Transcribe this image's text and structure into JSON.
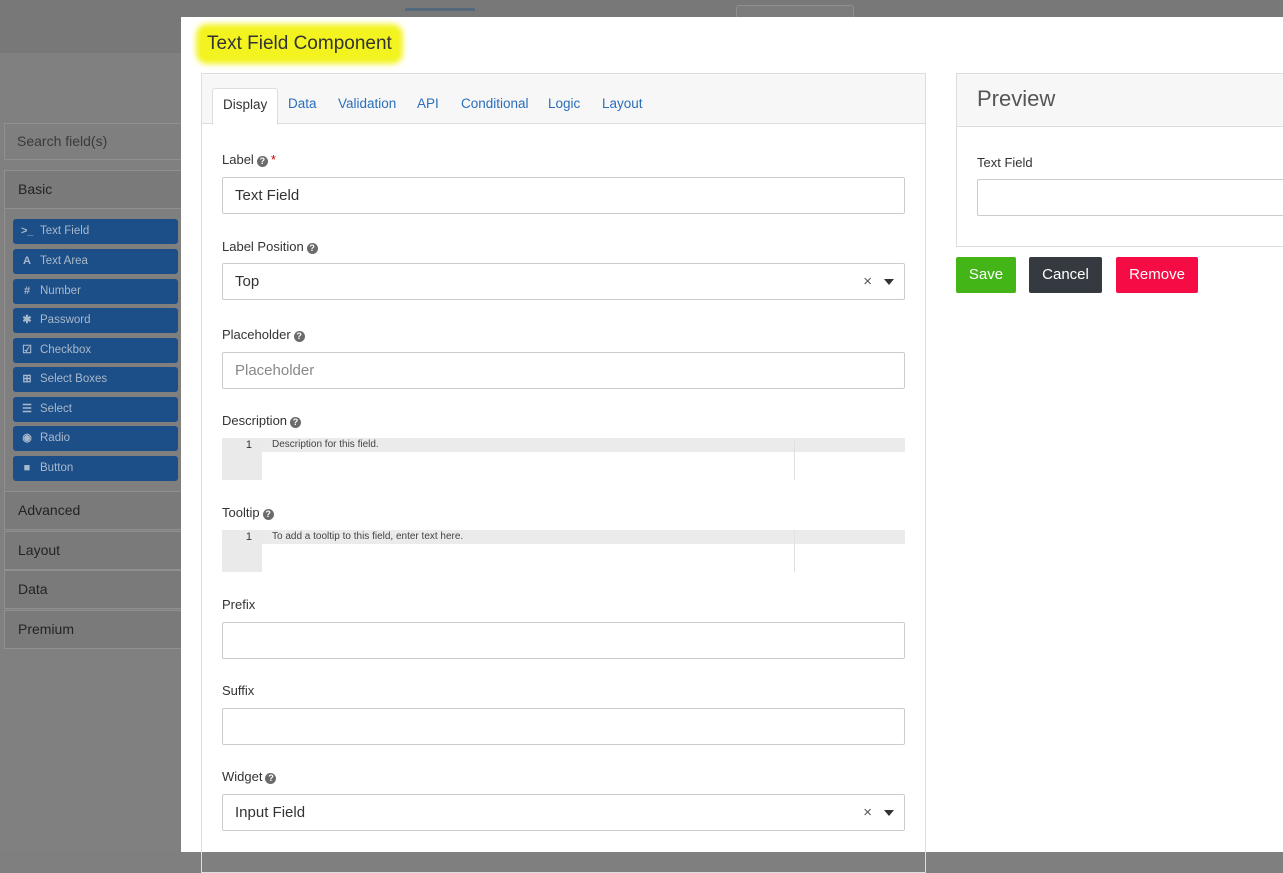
{
  "builder": {
    "search_placeholder": "Search field(s)",
    "groups": {
      "basic": "Basic",
      "advanced": "Advanced",
      "layout": "Layout",
      "data": "Data",
      "premium": "Premium"
    },
    "components": [
      {
        "label": "Text Field",
        "icon": "terminal-icon",
        "glyph": ">_"
      },
      {
        "label": "Text Area",
        "icon": "font-icon",
        "glyph": "A"
      },
      {
        "label": "Number",
        "icon": "hashtag-icon",
        "glyph": "#"
      },
      {
        "label": "Password",
        "icon": "asterisk-icon",
        "glyph": "✱"
      },
      {
        "label": "Checkbox",
        "icon": "check-square-icon",
        "glyph": "☑"
      },
      {
        "label": "Select Boxes",
        "icon": "plus-square-icon",
        "glyph": "⊞"
      },
      {
        "label": "Select",
        "icon": "list-icon",
        "glyph": "☰"
      },
      {
        "label": "Radio",
        "icon": "dot-circle-icon",
        "glyph": "◉"
      },
      {
        "label": "Button",
        "icon": "stop-icon",
        "glyph": "■"
      }
    ]
  },
  "modal": {
    "title": "Text Field Component",
    "tabs": [
      "Display",
      "Data",
      "Validation",
      "API",
      "Conditional",
      "Logic",
      "Layout"
    ],
    "active_tab": "Display",
    "fields": {
      "label": {
        "label": "Label",
        "value": "Text Field",
        "required_mark": "*"
      },
      "label_position": {
        "label": "Label Position",
        "value": "Top"
      },
      "placeholder": {
        "label": "Placeholder",
        "placeholder": "Placeholder"
      },
      "description": {
        "label": "Description",
        "line_number": "1",
        "placeholder": "Description for this field."
      },
      "tooltip": {
        "label": "Tooltip",
        "line_number": "1",
        "placeholder": "To add a tooltip to this field, enter text here."
      },
      "prefix": {
        "label": "Prefix",
        "value": ""
      },
      "suffix": {
        "label": "Suffix",
        "value": ""
      },
      "widget": {
        "label": "Widget",
        "value": "Input Field"
      }
    },
    "clear_glyph": "×",
    "help_glyph": "?",
    "preview": {
      "title": "Preview",
      "field_label": "Text Field"
    },
    "buttons": {
      "save": "Save",
      "cancel": "Cancel",
      "remove": "Remove"
    }
  },
  "colors": {
    "save": "#44b517",
    "cancel": "#343a40",
    "remove": "#f50c45",
    "highlight": "#f3f320",
    "link": "#2a6ebb",
    "component_button": "#1c4e87"
  }
}
